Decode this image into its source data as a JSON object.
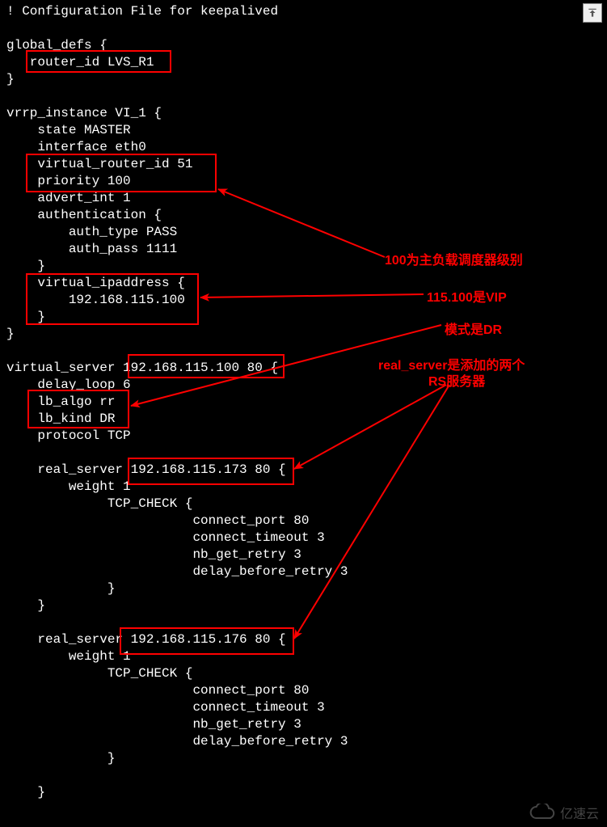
{
  "config": {
    "header": "! Configuration File for keepalived",
    "lines": "! Configuration File for keepalived\n\nglobal_defs {\n   router_id LVS_R1\n}\n\nvrrp_instance VI_1 {\n    state MASTER\n    interface eth0\n    virtual_router_id 51\n    priority 100\n    advert_int 1\n    authentication {\n        auth_type PASS\n        auth_pass 1111\n    }\n    virtual_ipaddress {\n        192.168.115.100\n    }\n}\n\nvirtual_server 192.168.115.100 80 {\n    delay_loop 6\n    lb_algo rr\n    lb_kind DR\n    protocol TCP\n\n    real_server 192.168.115.173 80 {\n        weight 1\n             TCP_CHECK {\n                        connect_port 80\n                        connect_timeout 3\n                        nb_get_retry 3\n                        delay_before_retry 3\n             }\n    }\n\n    real_server 192.168.115.176 80 {\n        weight 1\n             TCP_CHECK {\n                        connect_port 80\n                        connect_timeout 3\n                        nb_get_retry 3\n                        delay_before_retry 3\n             }\n\n    }"
  },
  "highlights": {
    "router_id": "router_id LVS_R1",
    "vrrp_block": "virtual_router_id 51 / priority 100",
    "vip_block": "virtual_ipaddress { 192.168.115.100 }",
    "vs_ip": "192.168.115.100 80",
    "lb_block": "lb_algo rr / lb_kind DR",
    "rs1": "192.168.115.173 80 {",
    "rs2": "192.168.115.176 80 {"
  },
  "annotations": {
    "priority_note": "100为主负载调度器级别",
    "vip_note": "115.100是VIP",
    "mode_note": "模式是DR",
    "rs_note_l1": "real_server是添加的两个",
    "rs_note_l2": "RS服务器"
  },
  "watermark": {
    "text": "亿速云"
  },
  "colors": {
    "highlight": "#ff0000",
    "bg": "#000000",
    "fg": "#ffffff"
  }
}
